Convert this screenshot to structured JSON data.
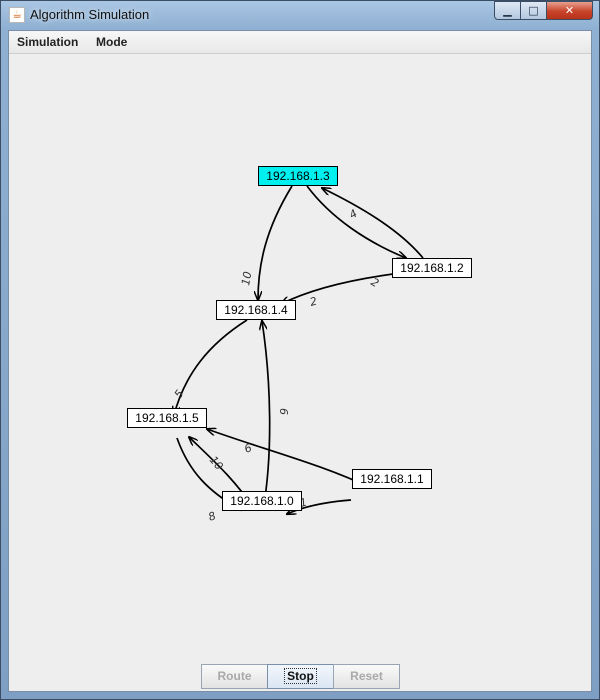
{
  "window": {
    "title": "Algorithm Simulation",
    "app_icon": "java-cup-icon",
    "controls": {
      "minimize": "▁",
      "maximize": "□",
      "close": "✕"
    }
  },
  "menu": {
    "items": [
      {
        "label": "Simulation"
      },
      {
        "label": "Mode"
      }
    ]
  },
  "graph": {
    "nodes": [
      {
        "id": "n3",
        "label": "192.168.1.3",
        "highlighted": true
      },
      {
        "id": "n2",
        "label": "192.168.1.2",
        "highlighted": false
      },
      {
        "id": "n4",
        "label": "192.168.1.4",
        "highlighted": false
      },
      {
        "id": "n5",
        "label": "192.168.1.5",
        "highlighted": false
      },
      {
        "id": "n1",
        "label": "192.168.1.1",
        "highlighted": false
      },
      {
        "id": "n0",
        "label": "192.168.1.0",
        "highlighted": false
      }
    ],
    "edges": [
      {
        "from": "192.168.1.3",
        "to": "192.168.1.4",
        "weight": "10"
      },
      {
        "from": "192.168.1.3",
        "to": "192.168.1.2",
        "weight": "2"
      },
      {
        "from": "192.168.1.2",
        "to": "192.168.1.3",
        "weight": "4"
      },
      {
        "from": "192.168.1.2",
        "to": "192.168.1.4",
        "weight": "2"
      },
      {
        "from": "192.168.1.4",
        "to": "192.168.1.5",
        "weight": "5"
      },
      {
        "from": "192.168.1.0",
        "to": "192.168.1.4",
        "weight": "6"
      },
      {
        "from": "192.168.1.1",
        "to": "192.168.1.5",
        "weight": "6"
      },
      {
        "from": "192.168.1.0",
        "to": "192.168.1.5",
        "weight": "10"
      },
      {
        "from": "192.168.1.5",
        "to": "192.168.1.0",
        "weight": "8"
      },
      {
        "from": "192.168.1.1",
        "to": "192.168.1.0",
        "weight": "1"
      }
    ],
    "colors": {
      "highlight": "#00f0f0",
      "edge": "#000000"
    }
  },
  "buttons": {
    "route": {
      "label": "Route",
      "enabled": false
    },
    "stop": {
      "label": "Stop",
      "enabled": true
    },
    "reset": {
      "label": "Reset",
      "enabled": false
    }
  }
}
